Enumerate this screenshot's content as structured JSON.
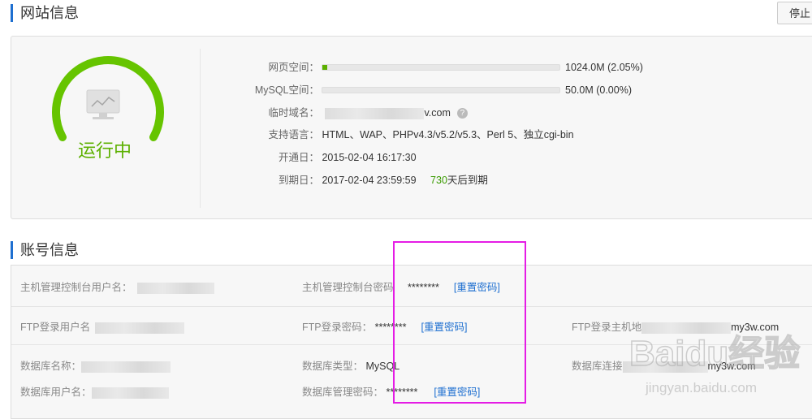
{
  "site_info": {
    "title": "网站信息",
    "stop_button": "停止",
    "status": "运行中",
    "rows": {
      "web_space": {
        "label": "网页空间：",
        "value": "1024.0M (2.05%)",
        "usage_percent": 2.05
      },
      "mysql_space": {
        "label": "MySQL空间：",
        "value": "50.0M (0.00%)",
        "usage_percent": 0.0
      },
      "temp_domain": {
        "label": "临时域名：",
        "value": "v.com",
        "help": "?"
      },
      "languages": {
        "label": "支持语言：",
        "value": "HTML、WAP、PHPv4.3/v5.2/v5.3、Perl 5、独立cgi-bin"
      },
      "open_date": {
        "label": "开通日：",
        "value": "2015-02-04 16:17:30"
      },
      "expire_date": {
        "label": "到期日：",
        "value": "2017-02-04 23:59:59",
        "days_left": "730",
        "days_suffix": "天后到期"
      }
    }
  },
  "account_info": {
    "title": "账号信息",
    "host_user": {
      "label": "主机管理控制台用户名："
    },
    "host_pwd": {
      "label": "主机管理控制台密码",
      "value": "********",
      "reset": "[重置密码]"
    },
    "ftp_user": {
      "label": "FTP登录用户名"
    },
    "ftp_pwd": {
      "label": "FTP登录密码：",
      "value": "********",
      "reset": "[重置密码]"
    },
    "ftp_host": {
      "label": "FTP登录主机地",
      "value": "my3w.com"
    },
    "db_name": {
      "label": "数据库名称："
    },
    "db_type": {
      "label": "数据库类型：",
      "value": "MySQL"
    },
    "db_host": {
      "label": "数据库连接",
      "value": "my3w.com"
    },
    "db_user": {
      "label": "数据库用户名："
    },
    "db_pwd": {
      "label": "数据库管理密码：",
      "value": "********",
      "reset": "[重置密码]"
    }
  },
  "watermark": {
    "brand": "Baidu经验",
    "url": "jingyan.baidu.com"
  },
  "colors": {
    "accent": "#1e6fd0",
    "running": "#5cb000",
    "highlight": "#e51ce5"
  }
}
